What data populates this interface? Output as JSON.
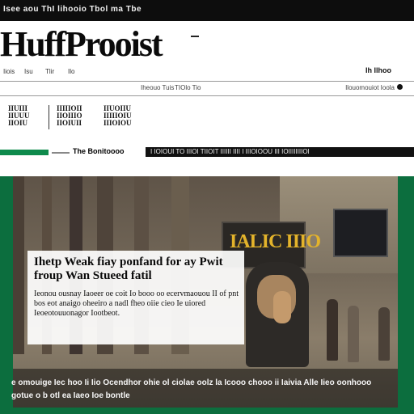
{
  "topbar": {
    "text": "Isee aou ThI lihooio Tbol ma Tbe"
  },
  "logo": {
    "text": "HuffProoist"
  },
  "nav": {
    "items": [
      "Iiois",
      "Isu",
      "Tlir",
      "Ilo"
    ],
    "location": "Ih Ilhoo"
  },
  "subnav": {
    "items": [
      "Iheouo Tuis",
      "TIOlo Tio"
    ],
    "right_text": "Ilouomouiot Ioola"
  },
  "sections": [
    {
      "label": "IIUIII\nIIUUU\nIIOIU"
    },
    {
      "label": "IIIIIOII\nIIOIIIO\nIIOIUII"
    },
    {
      "label": "IIUOIIU\nIIIIIOIU\nIIIOIOU"
    }
  ],
  "ticker": {
    "label": "The Bonitoooo",
    "bar_text": "I IOIOUI TO IIIOI TIIOIT IIIIII IIII I IIIOIOOU III IOIIIIIIIIOI"
  },
  "hero": {
    "sign_text": "IALIC IIIO",
    "headline": "Ihetp Weak fiay ponfand for ay Pwit froup Wan Stueed fatil",
    "deck": "Ieonou ousnay Iaoeer oe coit Io booo oo ecervmaouou II of pnt bos eot anaigo oheeiro a nadl fheo oiie cieo Ie uiored Ieoeotouuonagor Iootbeot.",
    "caption": "e omouige Iec hoo Ii Iio Ocendhor ohie ol ciolae oolz la Icooo chooo ii Iaivia Alle Iieo oonhooo gotue o b otl ea Iaeo Ioe bontle"
  },
  "colors": {
    "accent_green": "#0e8a4c",
    "hero_frame": "#0c6e3e",
    "topbar": "#0d0d0d",
    "sign_yellow": "#e3b32b"
  },
  "icons": {
    "sub_icon": "user-icon"
  }
}
